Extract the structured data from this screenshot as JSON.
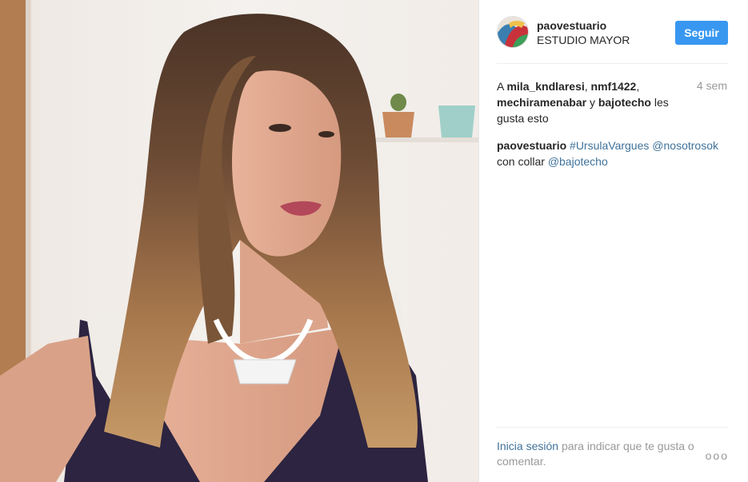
{
  "post": {
    "username": "paovestuario",
    "location": "ESTUDIO MAYOR",
    "follow_label": "Seguir",
    "time": "4 sem",
    "likes": {
      "prefix": "A",
      "users": [
        "mila_kndlaresi",
        "nmf1422",
        "mechiramenabar",
        "bajotecho"
      ],
      "sep1": ",",
      "sep2": ",",
      "conj": "y",
      "suffix": "les gusta esto"
    },
    "caption": {
      "user": "paovestuario",
      "hashtag": "#UrsulaVargues",
      "mention1": "@nosotrosok",
      "text": "con collar",
      "mention2": "@bajotecho"
    },
    "footer": {
      "login": "Inicia sesión",
      "text": "para indicar que te gusta o comentar."
    },
    "more_label": "ooo"
  },
  "colors": {
    "accent": "#3897f0",
    "link": "#3f729b",
    "muted": "#999999"
  },
  "icons": [
    "more-options-icon"
  ]
}
